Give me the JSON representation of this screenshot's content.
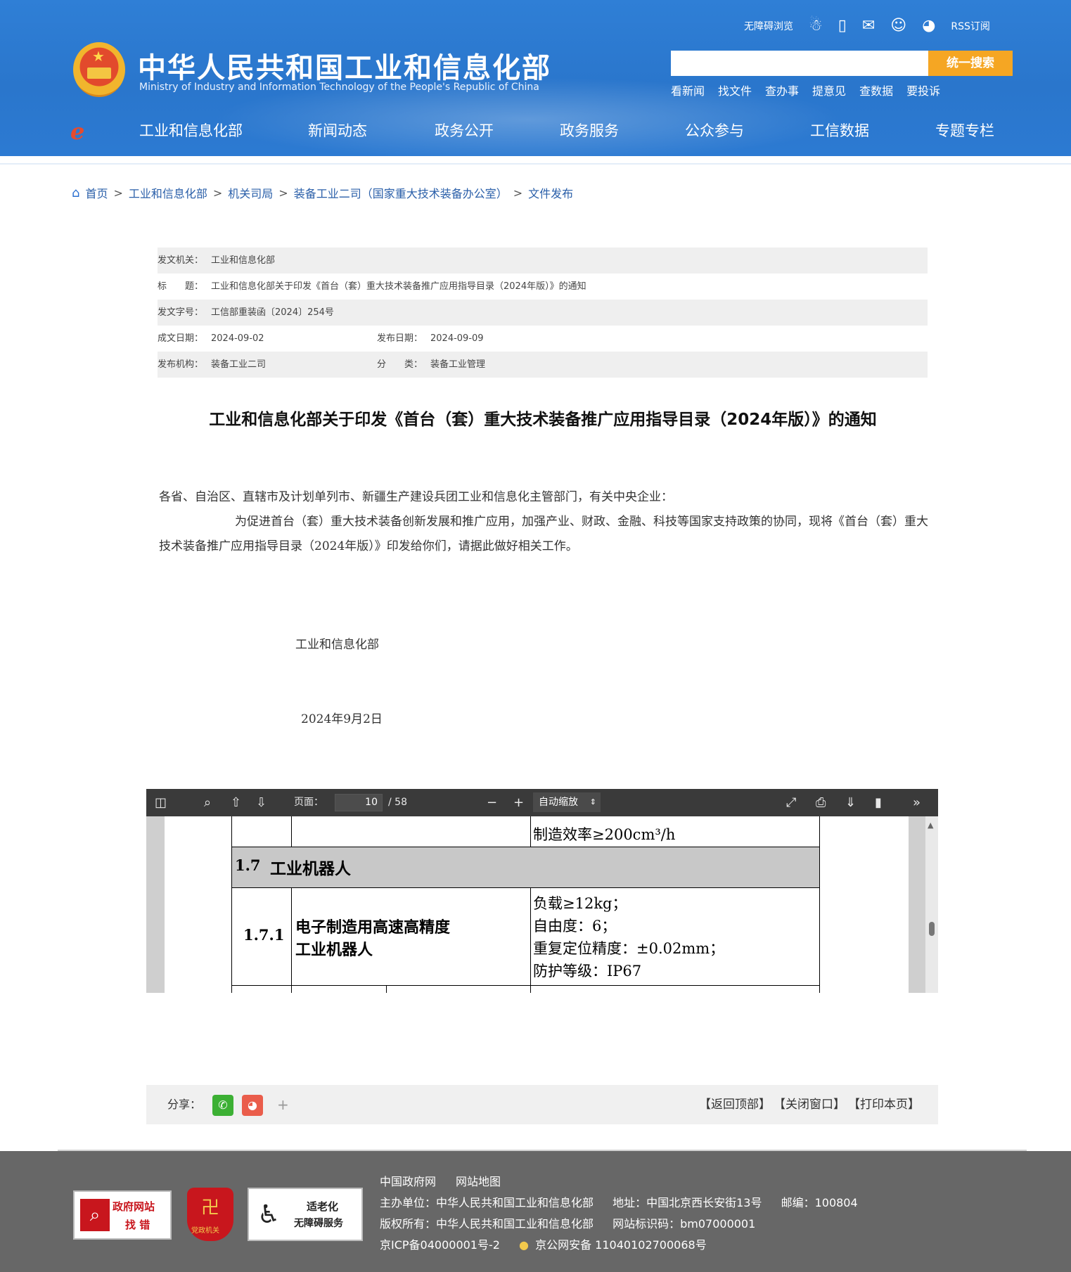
{
  "header": {
    "title_cn": "中华人民共和国工业和信息化部",
    "title_en": "Ministry of Industry and Information Technology of the People's Republic of China",
    "accessibility_link": "无障碍浏览",
    "rss_link": "RSS订阅",
    "search": {
      "placeholder": "",
      "button": "统一搜索"
    },
    "quick_links": [
      "看新闻",
      "找文件",
      "查办事",
      "提意见",
      "查数据",
      "要投诉"
    ],
    "nav": [
      "工业和信息化部",
      "新闻动态",
      "政务公开",
      "政务服务",
      "公众参与",
      "工信数据",
      "专题专栏"
    ]
  },
  "breadcrumb": [
    "首页",
    "工业和信息化部",
    "机关司局",
    "装备工业二司（国家重大技术装备办公室）",
    "文件发布"
  ],
  "meta": {
    "issuer_label": "发文机关：",
    "issuer": "工业和信息化部",
    "title_label": "标　　题：",
    "title": "工业和信息化部关于印发《首台（套）重大技术装备推广应用指导目录（2024年版）》的通知",
    "doc_no_label": "发文字号：",
    "doc_no": "工信部重装函〔2024〕254号",
    "created_label": "成文日期：",
    "created": "2024-09-02",
    "published_label": "发布日期：",
    "published": "2024-09-09",
    "agency_label": "发布机构：",
    "agency": "装备工业二司",
    "category_label": "分　　类：",
    "category": "装备工业管理"
  },
  "document": {
    "title": "工业和信息化部关于印发《首台（套）重大技术装备推广应用指导目录（2024年版）》的通知",
    "salutation": "各省、自治区、直辖市及计划单列市、新疆生产建设兵团工业和信息化主管部门，有关中央企业：",
    "paragraph": "为促进首台（套）重大技术装备创新发展和推广应用，加强产业、财政、金融、科技等国家支持政策的协同，现将《首台（套）重大技术装备推广应用指导目录（2024年版）》印发给你们，请据此做好相关工作。",
    "signature": "工业和信息化部",
    "date": "2024年9月2日"
  },
  "pdf_viewer": {
    "page_label": "页面：",
    "page_current": "10",
    "page_total": "/ 58",
    "zoom": "自动缩放",
    "content": {
      "top_cell": "制造效率≥200cm³/h",
      "section_no": "1.7",
      "section_title": "工业机器人",
      "item_no": "1.7.1",
      "item_name_line1": "电子制造用高速高精度",
      "item_name_line2": "工业机器人",
      "spec_1": "负载≥12kg；",
      "spec_2": "自由度：6；",
      "spec_3": "重复定位精度：±0.02mm；",
      "spec_4": "防护等级：IP67"
    }
  },
  "share": {
    "label": "分享：",
    "more": "+",
    "actions": [
      "【返回顶部】",
      "【关闭窗口】",
      "【打印本页】"
    ]
  },
  "footer": {
    "links": [
      "中国政府网",
      "网站地图"
    ],
    "sponsor": "主办单位：中华人民共和国工业和信息化部",
    "address": "地址：中国北京西长安街13号",
    "postcode": "邮编：100804",
    "copyright": "版权所有：中华人民共和国工业和信息化部",
    "site_code": "网站标识码：bm07000001",
    "icp": "京ICP备04000001号-2",
    "police": "京公网安备 11040102700068号",
    "badge_gov_error_1": "政府网站",
    "badge_gov_error_2": "找 错",
    "badge_party": "党政机关",
    "badge_elderly_1": "适老化",
    "badge_elderly_2": "无障碍服务"
  },
  "colors": {
    "header_blue": "#2c7ad2",
    "search_orange": "#f5a623",
    "link_blue": "#2a5fa9",
    "footer_gray": "#676767"
  }
}
